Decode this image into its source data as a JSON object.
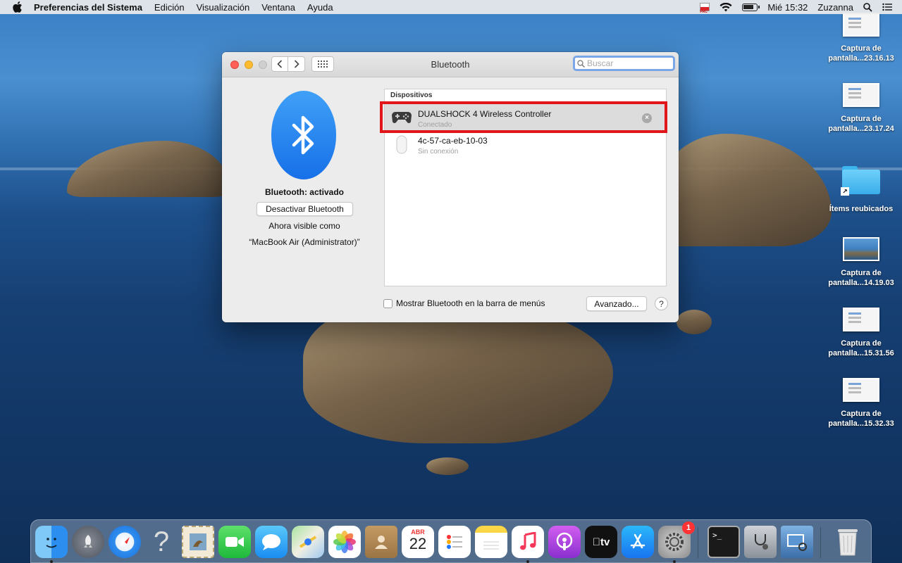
{
  "menubar": {
    "app_name": "Preferencias del Sistema",
    "menus": [
      "Edición",
      "Visualización",
      "Ventana",
      "Ayuda"
    ],
    "clock": "Mié 15:32",
    "user": "Zuzanna",
    "flag_label": "PRC"
  },
  "desktop": {
    "icons": [
      {
        "label1": "Captura de",
        "label2": "pantalla...23.16.13",
        "kind": "screenshot"
      },
      {
        "label1": "Captura de",
        "label2": "pantalla...23.17.24",
        "kind": "screenshot"
      },
      {
        "label1": "Ítems reubicados",
        "label2": "",
        "kind": "folder"
      },
      {
        "label1": "Captura de",
        "label2": "pantalla...14.19.03",
        "kind": "photo"
      },
      {
        "label1": "Captura de",
        "label2": "pantalla...15.31.56",
        "kind": "screenshot"
      },
      {
        "label1": "Captura de",
        "label2": "pantalla...15.32.33",
        "kind": "screenshot"
      }
    ]
  },
  "window": {
    "title": "Bluetooth",
    "search_placeholder": "Buscar",
    "status": "Bluetooth: activado",
    "toggle_label": "Desactivar Bluetooth",
    "visible_as": "Ahora visible como",
    "machine_name": "“MacBook Air (Administrator)”",
    "devices_header": "Dispositivos",
    "devices": [
      {
        "name": "DUALSHOCK 4 Wireless Controller",
        "status": "Conectado",
        "icon": "gamepad-icon"
      },
      {
        "name": "4c-57-ca-eb-10-03",
        "status": "Sin conexión",
        "icon": "mouse-icon"
      }
    ],
    "show_in_menubar_label": "Mostrar Bluetooth en la barra de menús",
    "advanced_label": "Avanzado...",
    "help_label": "?"
  },
  "dock": {
    "items": [
      "Finder",
      "Launchpad",
      "Safari",
      "Help",
      "Mail",
      "FaceTime",
      "Messages",
      "Maps",
      "Photos",
      "Contacts",
      "Calendar",
      "Reminders",
      "Notes",
      "Music",
      "Podcasts",
      "TV",
      "App Store",
      "System Preferences",
      "Terminal",
      "Disk Utility",
      "Preview",
      "Trash"
    ],
    "calendar_month": "ABR",
    "calendar_day": "22",
    "prefs_badge": "1",
    "tv_label": "tv"
  },
  "colors": {
    "highlight": "#e0161b",
    "bluetooth": "#1770e8",
    "search_focus": "#7ba7e8"
  }
}
